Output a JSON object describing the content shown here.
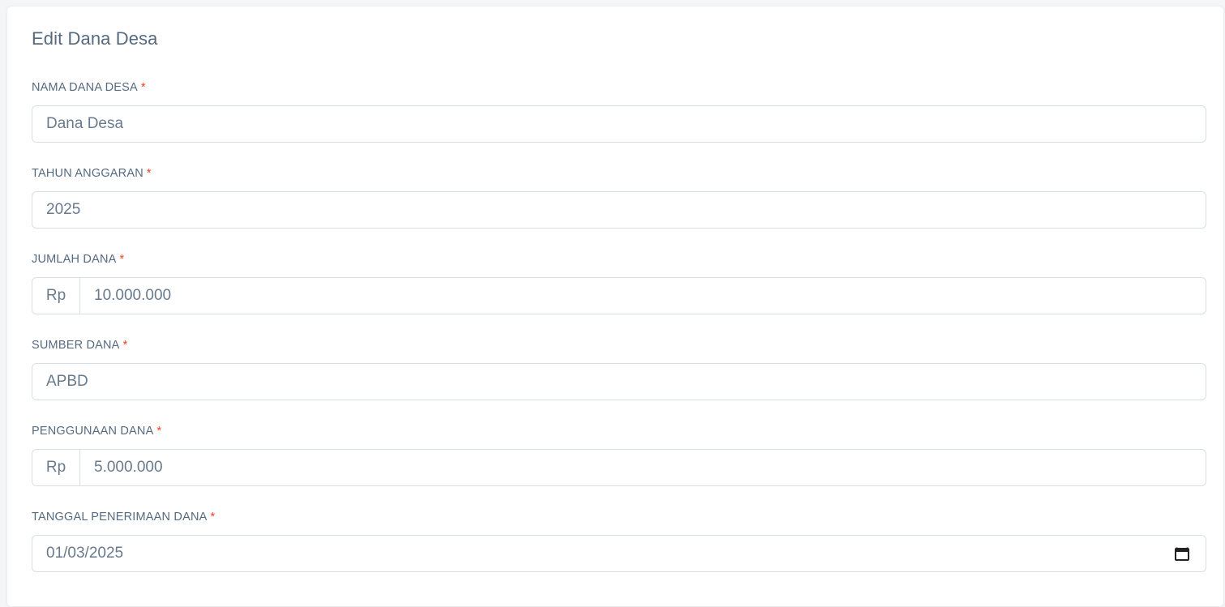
{
  "form": {
    "title": "Edit Dana Desa",
    "required_mark": "*",
    "fields": [
      {
        "label": "NAMA DANA DESA",
        "value": "Dana Desa"
      },
      {
        "label": "TAHUN ANGGARAN",
        "value": "2025"
      },
      {
        "label": "JUMLAH DANA",
        "prefix": "Rp",
        "value": "10.000.000"
      },
      {
        "label": "SUMBER DANA",
        "value": "APBD"
      },
      {
        "label": "PENGGUNAAN DANA",
        "prefix": "Rp",
        "value": "5.000.000"
      },
      {
        "label": "TANGGAL PENERIMAAN DANA",
        "value": "01/03/2025",
        "icon": "calendar-icon"
      }
    ]
  },
  "colors": {
    "label": "#566a7f",
    "required": "#ff3e1d",
    "border": "#d9dee3",
    "text": "#697a8d"
  }
}
